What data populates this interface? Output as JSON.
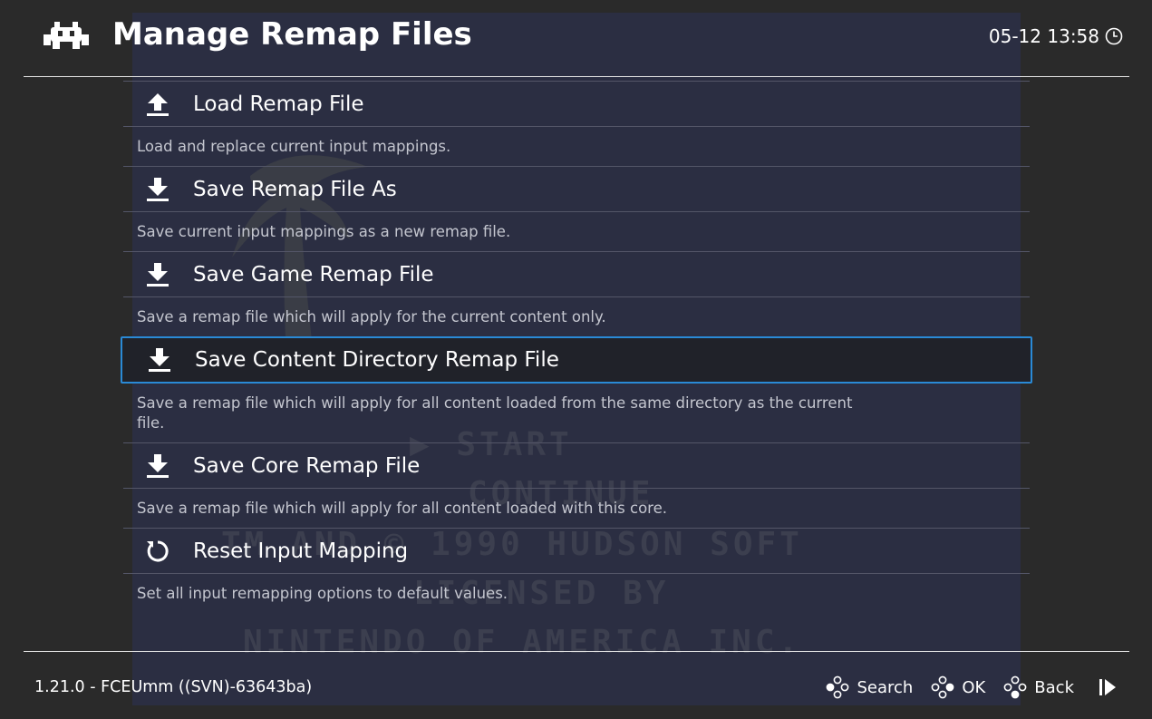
{
  "header": {
    "title": "Manage Remap Files",
    "clock": "05-12 13:58"
  },
  "background_game": {
    "lines": [
      "▶ START",
      "CONTINUE",
      "TM AND © 1990 HUDSON SOFT",
      "LICENSED BY",
      "NINTENDO OF AMERICA INC."
    ]
  },
  "menu": {
    "items": [
      {
        "label": "Load Remap File",
        "icon": "upload-icon",
        "description": "Load and replace current input mappings."
      },
      {
        "label": "Save Remap File As",
        "icon": "download-icon",
        "description": "Save current input mappings as a new remap file."
      },
      {
        "label": "Save Game Remap File",
        "icon": "download-icon",
        "description": "Save a remap file which will apply for the current content only."
      },
      {
        "label": "Save Content Directory Remap File",
        "icon": "download-icon",
        "description": "Save a remap file which will apply for all content loaded from the same directory as the current file.",
        "selected": true
      },
      {
        "label": "Save Core Remap File",
        "icon": "download-icon",
        "description": "Save a remap file which will apply for all content loaded with this core."
      },
      {
        "label": "Reset Input Mapping",
        "icon": "reset-icon",
        "description": "Set all input remapping options to default values."
      }
    ]
  },
  "footer": {
    "version": "1.21.0 - FCEUmm ((SVN)-63643ba)",
    "actions": [
      {
        "label": "Search",
        "icon": "gamepad-buttons-icon"
      },
      {
        "label": "OK",
        "icon": "gamepad-buttons-icon"
      },
      {
        "label": "Back",
        "icon": "gamepad-buttons-icon"
      }
    ]
  },
  "colors": {
    "accent": "#2a8ad6",
    "background": "#2a2a2a",
    "panel": "#2b2e42",
    "selected_bg": "#202229"
  }
}
